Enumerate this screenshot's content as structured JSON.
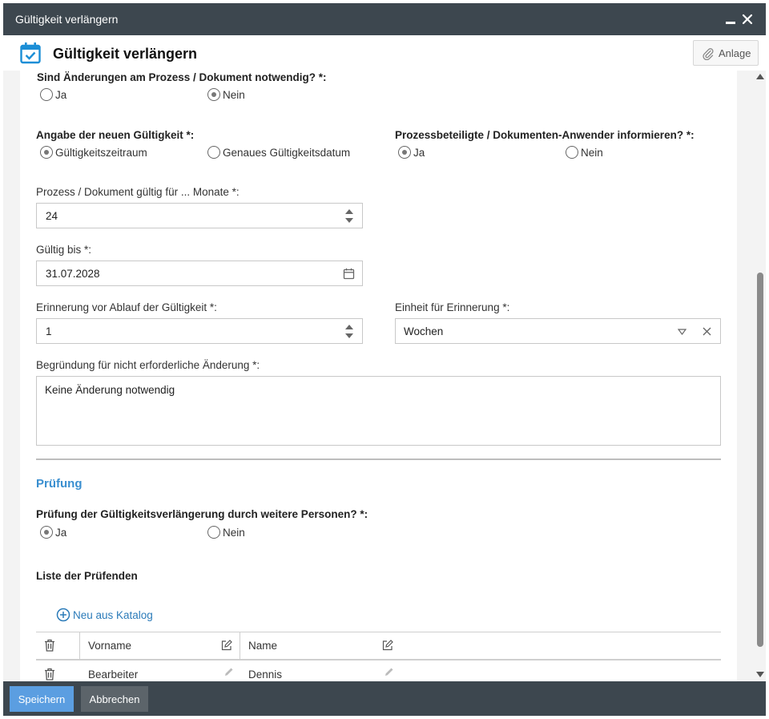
{
  "window": {
    "title": "Gültigkeit verlängern"
  },
  "header": {
    "title": "Gültigkeit verlängern",
    "attachment_label": "Anlage"
  },
  "colors": {
    "titlebar": "#3d474f",
    "accent": "#3a8fd0",
    "link": "#2b7bb9",
    "save_button": "#5b9ee1",
    "cancel_button": "#5c646a",
    "calendar_icon": "#1b8ed6"
  },
  "form": {
    "changes_needed": {
      "question": "Sind Änderungen am Prozess / Dokument notwendig? *:",
      "options": [
        "Ja",
        "Nein"
      ],
      "selected": "Nein"
    },
    "new_validity": {
      "question": "Angabe der neuen Gültigkeit *:",
      "options": [
        "Gültigkeitszeitraum",
        "Genaues Gültigkeitsdatum"
      ],
      "selected": "Gültigkeitszeitraum"
    },
    "inform_participants": {
      "question": "Prozessbeteiligte / Dokumenten-Anwender informieren? *:",
      "options": [
        "Ja",
        "Nein"
      ],
      "selected": "Ja"
    },
    "months": {
      "label": "Prozess / Dokument gültig für ... Monate *:",
      "value": "24"
    },
    "valid_until": {
      "label": "Gültig bis *:",
      "value": "31.07.2028"
    },
    "reminder": {
      "label": "Erinnerung vor Ablauf der Gültigkeit *:",
      "value": "1"
    },
    "reminder_unit": {
      "label": "Einheit für Erinnerung *:",
      "value": "Wochen"
    },
    "reason": {
      "label": "Begründung für nicht erforderliche Änderung *:",
      "value": "Keine Änderung notwendig"
    }
  },
  "review": {
    "section_title": "Prüfung",
    "further_review": {
      "question": "Prüfung der Gültigkeitsverlängerung durch weitere Personen? *:",
      "options": [
        "Ja",
        "Nein"
      ],
      "selected": "Ja"
    },
    "list_title": "Liste der Prüfenden",
    "new_from_catalog": "Neu aus Katalog",
    "columns": [
      "Vorname",
      "Name"
    ],
    "rows": [
      {
        "vorname": "Bearbeiter",
        "name": "Dennis"
      }
    ]
  },
  "footer": {
    "save_label": "Speichern",
    "cancel_label": "Abbrechen"
  }
}
